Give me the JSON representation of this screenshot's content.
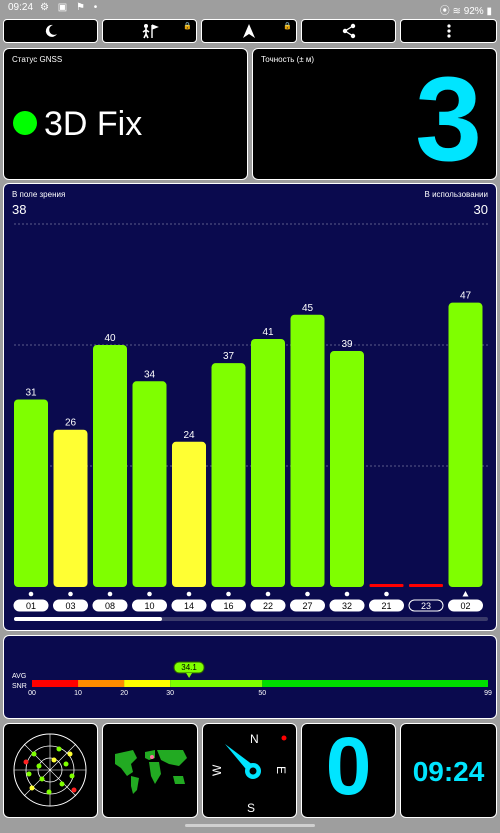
{
  "status_bar": {
    "time": "09:24",
    "battery": "92%"
  },
  "toolbar": {
    "buttons": [
      {
        "name": "night-mode",
        "icon": "moon-icon",
        "locked": false
      },
      {
        "name": "map-view",
        "icon": "person-flag-icon",
        "locked": true
      },
      {
        "name": "navigate",
        "icon": "navigation-arrow-icon",
        "locked": true
      },
      {
        "name": "share",
        "icon": "share-icon",
        "locked": false
      },
      {
        "name": "menu",
        "icon": "more-vertical-icon",
        "locked": false
      }
    ]
  },
  "gnss_status": {
    "label": "Статус GNSS",
    "value": "3D Fix",
    "indicator_color": "#00ff00"
  },
  "accuracy": {
    "label": "Точность (± м)",
    "value": "3"
  },
  "satellites": {
    "in_view_label": "В поле зрения",
    "in_view": "38",
    "in_use_label": "В использовании",
    "in_use": "30"
  },
  "chart_data": {
    "type": "bar",
    "categories": [
      "01",
      "03",
      "08",
      "10",
      "14",
      "16",
      "22",
      "27",
      "32",
      "21",
      "23",
      "02"
    ],
    "values": [
      31,
      26,
      40,
      34,
      24,
      37,
      41,
      45,
      39,
      0,
      0,
      47
    ],
    "bar_colors": [
      "#7fff00",
      "#ffff33",
      "#7fff00",
      "#7fff00",
      "#ffff33",
      "#7fff00",
      "#7fff00",
      "#7fff00",
      "#7fff00",
      "#ff0000",
      "#ff0000",
      "#7fff00"
    ],
    "markers": [
      "dot",
      "dot",
      "dot",
      "dot",
      "dot",
      "dot",
      "dot",
      "dot",
      "dot",
      "dot",
      "none",
      "triangle"
    ],
    "outlined": [
      false,
      false,
      false,
      false,
      false,
      false,
      false,
      false,
      false,
      false,
      true,
      false
    ],
    "ylim": [
      0,
      60
    ],
    "grid": true
  },
  "snr_bar": {
    "avg_label": "AVG",
    "snr_label": "SNR",
    "avg_value": "34.1",
    "ticks": [
      "00",
      "10",
      "20",
      "30",
      "50",
      "99"
    ],
    "tick_values": [
      0,
      10,
      20,
      30,
      50,
      99
    ],
    "max": 99,
    "segments": [
      {
        "from": 0,
        "to": 10,
        "color": "#ff0000"
      },
      {
        "from": 10,
        "to": 20,
        "color": "#ff8c00"
      },
      {
        "from": 20,
        "to": 30,
        "color": "#ffff00"
      },
      {
        "from": 30,
        "to": 50,
        "color": "#7fff00"
      },
      {
        "from": 50,
        "to": 99,
        "color": "#00dd00"
      }
    ]
  },
  "bottom": {
    "compass": {
      "n": "N",
      "e": "E",
      "s": "S",
      "w": "W"
    },
    "speed": "0",
    "clock": "09:24"
  }
}
